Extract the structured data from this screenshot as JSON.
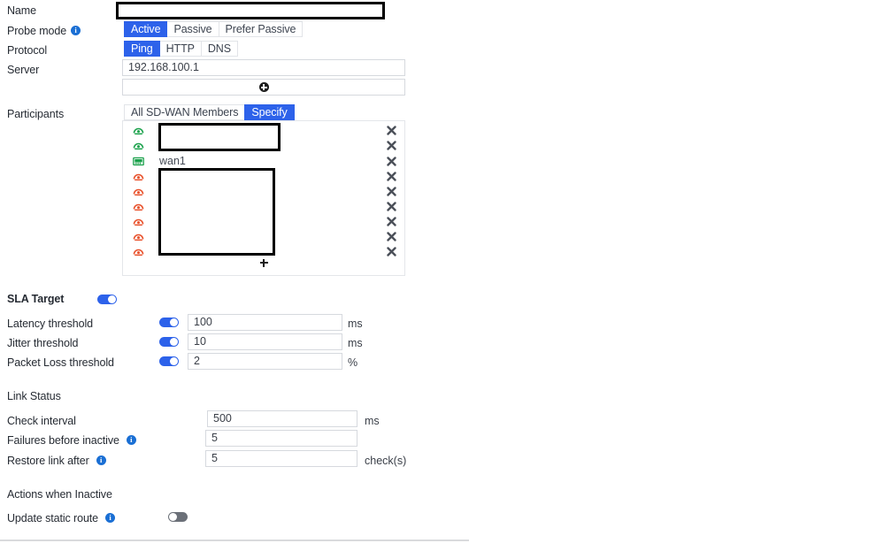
{
  "form": {
    "name": {
      "label": "Name",
      "value": "",
      "redacted": true
    },
    "probe_mode": {
      "label": "Probe mode",
      "info_icon": "info-icon",
      "options": [
        "Active",
        "Passive",
        "Prefer Passive"
      ],
      "selected": "Active"
    },
    "protocol": {
      "label": "Protocol",
      "options": [
        "Ping",
        "HTTP",
        "DNS"
      ],
      "selected": "Ping"
    },
    "server": {
      "label": "Server",
      "value": "192.168.100.1",
      "add_icon": "plus-circle-icon"
    },
    "participants": {
      "label": "Participants",
      "options": [
        "All SD-WAN Members",
        "Specify"
      ],
      "selected": "Specify",
      "add_icon": "plus-icon",
      "delete_icon": "close-x-icon",
      "rows": [
        {
          "icon": "interface-status-up-icon",
          "icon_color": "#1aa14b",
          "name": "",
          "redacted": true
        },
        {
          "icon": "interface-status-up-icon",
          "icon_color": "#1aa14b",
          "name": "",
          "redacted": true
        },
        {
          "icon": "switch-interface-icon",
          "icon_color": "#1aa14b",
          "name": "wan1",
          "redacted": false
        },
        {
          "icon": "interface-status-down-icon",
          "icon_color": "#e8502a",
          "name": "",
          "redacted": true
        },
        {
          "icon": "interface-status-down-icon",
          "icon_color": "#e8502a",
          "name": "",
          "redacted": true
        },
        {
          "icon": "interface-status-down-icon",
          "icon_color": "#e8502a",
          "name": "",
          "redacted": true
        },
        {
          "icon": "interface-status-down-icon",
          "icon_color": "#e8502a",
          "name": "",
          "redacted": true
        },
        {
          "icon": "interface-status-down-icon",
          "icon_color": "#e8502a",
          "name": "",
          "redacted": true
        },
        {
          "icon": "interface-status-down-icon",
          "icon_color": "#e8502a",
          "name": "",
          "redacted": true
        }
      ]
    }
  },
  "sla_target": {
    "title": "SLA Target",
    "enabled": true,
    "latency": {
      "label": "Latency threshold",
      "enabled": true,
      "value": "100",
      "unit": "ms"
    },
    "jitter": {
      "label": "Jitter threshold",
      "enabled": true,
      "value": "10",
      "unit": "ms"
    },
    "packet_loss": {
      "label": "Packet Loss threshold",
      "enabled": true,
      "value": "2",
      "unit": "%"
    }
  },
  "link_status": {
    "title": "Link Status",
    "check_interval": {
      "label": "Check interval",
      "value": "500",
      "unit": "ms"
    },
    "failures_before_inactive": {
      "label": "Failures before inactive",
      "info_icon": "info-icon",
      "value": "5",
      "unit": ""
    },
    "restore_link_after": {
      "label": "Restore link after",
      "info_icon": "info-icon",
      "value": "5",
      "unit": "check(s)"
    }
  },
  "actions_when_inactive": {
    "title": "Actions when Inactive",
    "update_static_route": {
      "label": "Update static route",
      "info_icon": "info-icon",
      "enabled": false
    }
  },
  "colors": {
    "accent_blue": "#2d62ea",
    "info_blue": "#1a6fd4",
    "status_up_green": "#1aa14b",
    "status_down_red": "#e8502a",
    "border_gray": "#d6d9de",
    "divider_gray": "#d9dadd"
  }
}
